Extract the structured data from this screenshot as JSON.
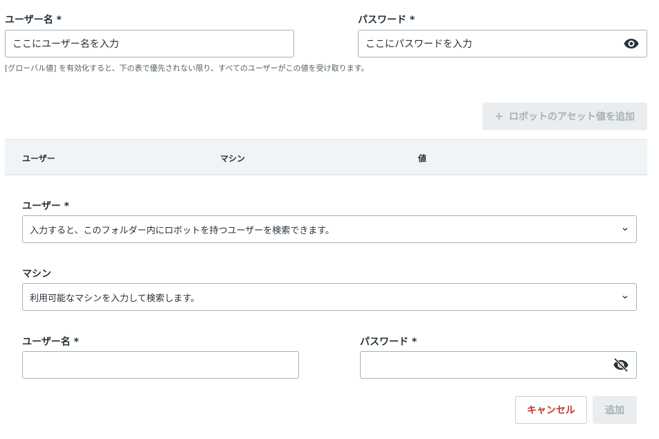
{
  "global": {
    "username_label": "ユーザー名 *",
    "username_value": "ここにユーザー名を入力",
    "password_label": "パスワード *",
    "password_value": "ここにパスワードを入力",
    "hint": "[グローバル値] を有効化すると、下の表で優先されない限り、すべてのユーザーがこの値を受け取ります。"
  },
  "add_robot_button": {
    "icon": "plus-icon",
    "label": "ロボットのアセット値を追加"
  },
  "table": {
    "columns": [
      "ユーザー",
      "マシン",
      "値"
    ]
  },
  "form": {
    "user_label": "ユーザー *",
    "user_placeholder": "入力すると、このフォルダー内にロボットを持つユーザーを検索できます。",
    "machine_label": "マシン",
    "machine_placeholder": "利用可能なマシンを入力して検索します。",
    "username_label": "ユーザー名 *",
    "username_value": "",
    "password_label": "パスワード *",
    "password_value": "",
    "password_icon": "eye-off-icon",
    "cancel_label": "キャンセル",
    "add_label": "追加"
  },
  "colors": {
    "text": "#273139",
    "border": "#a4b1b8",
    "table_header_bg": "#f0f4f7",
    "disabled_bg": "#e9edef",
    "cancel_text": "#c0392b"
  }
}
